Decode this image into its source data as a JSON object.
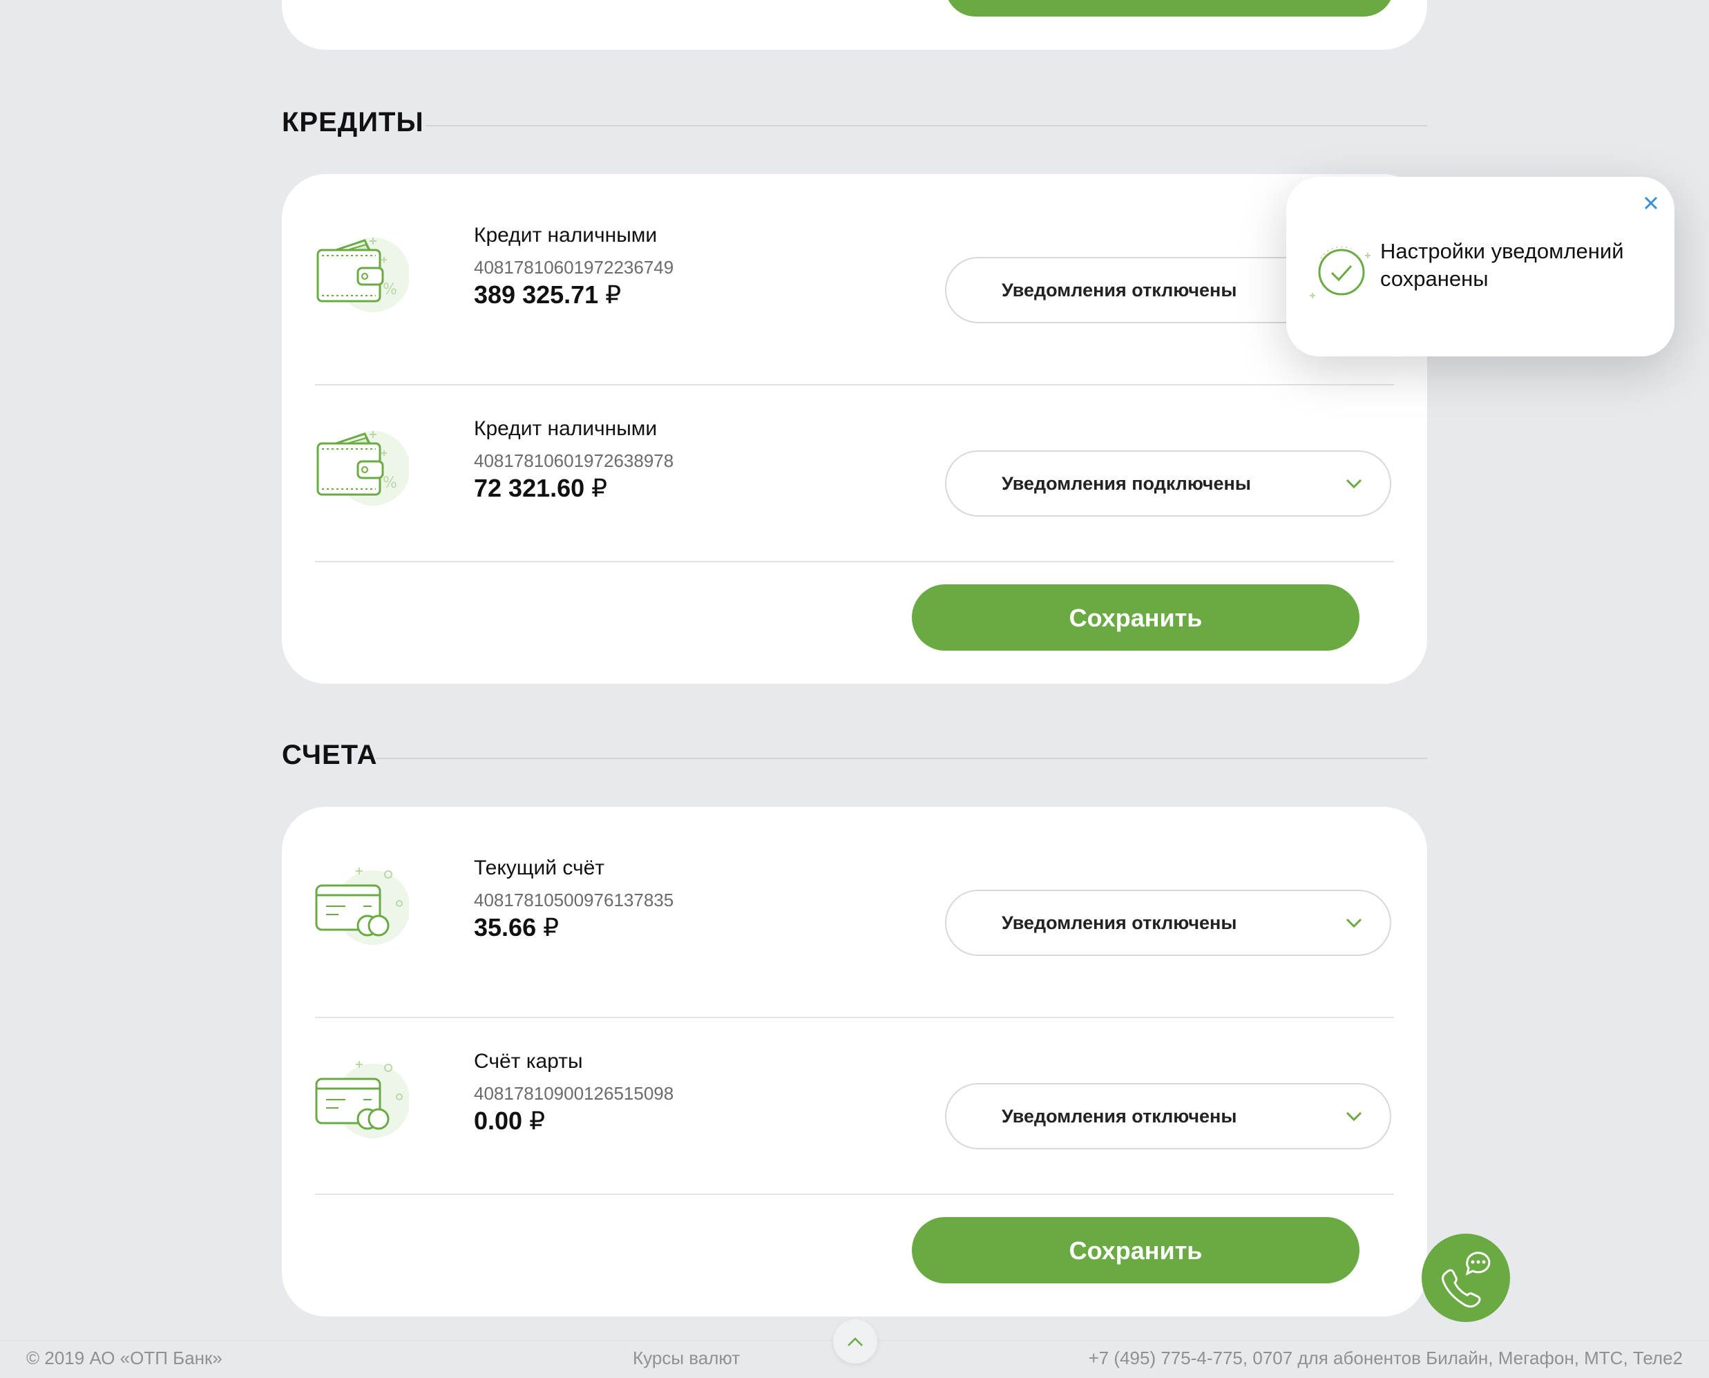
{
  "sections": [
    {
      "title": "КРЕДИТЫ",
      "products": [
        {
          "name": "Кредит наличными",
          "account": "40817810601972236749",
          "amount": "389 325.71",
          "currency": "₽",
          "status": "Уведомления отключены",
          "icon": "wallet-icon"
        },
        {
          "name": "Кредит наличными",
          "account": "40817810601972638978",
          "amount": "72 321.60",
          "currency": "₽",
          "status": "Уведомления подключены",
          "icon": "wallet-icon"
        }
      ],
      "save_label": "Сохранить"
    },
    {
      "title": "СЧЕТА",
      "products": [
        {
          "name": "Текущий счёт",
          "account": "40817810500976137835",
          "amount": "35.66",
          "currency": "₽",
          "status": "Уведомления отключены",
          "icon": "card-coins-icon"
        },
        {
          "name": "Счёт карты",
          "account": "40817810900126515098",
          "amount": "0.00",
          "currency": "₽",
          "status": "Уведомления отключены",
          "icon": "card-coins-icon"
        }
      ],
      "save_label": "Сохранить"
    }
  ],
  "toast": {
    "message": "Настройки уведомлений сохранены",
    "icon": "check-circle-icon",
    "close_icon": "close-icon"
  },
  "footer": {
    "copyright": "© 2019 АО «ОТП Банк»",
    "rates_link": "Курсы валют",
    "phone": "+7 (495) 775-4-775,  0707 для абонентов Билайн, Мегафон, МТС, Теле2",
    "scroll_up_icon": "chevron-up-icon"
  },
  "fab": {
    "icon": "phone-chat-icon"
  },
  "colors": {
    "accent": "#6aaa43",
    "background": "#e8e9ec",
    "card": "#ffffff",
    "close": "#3b8fd4"
  }
}
